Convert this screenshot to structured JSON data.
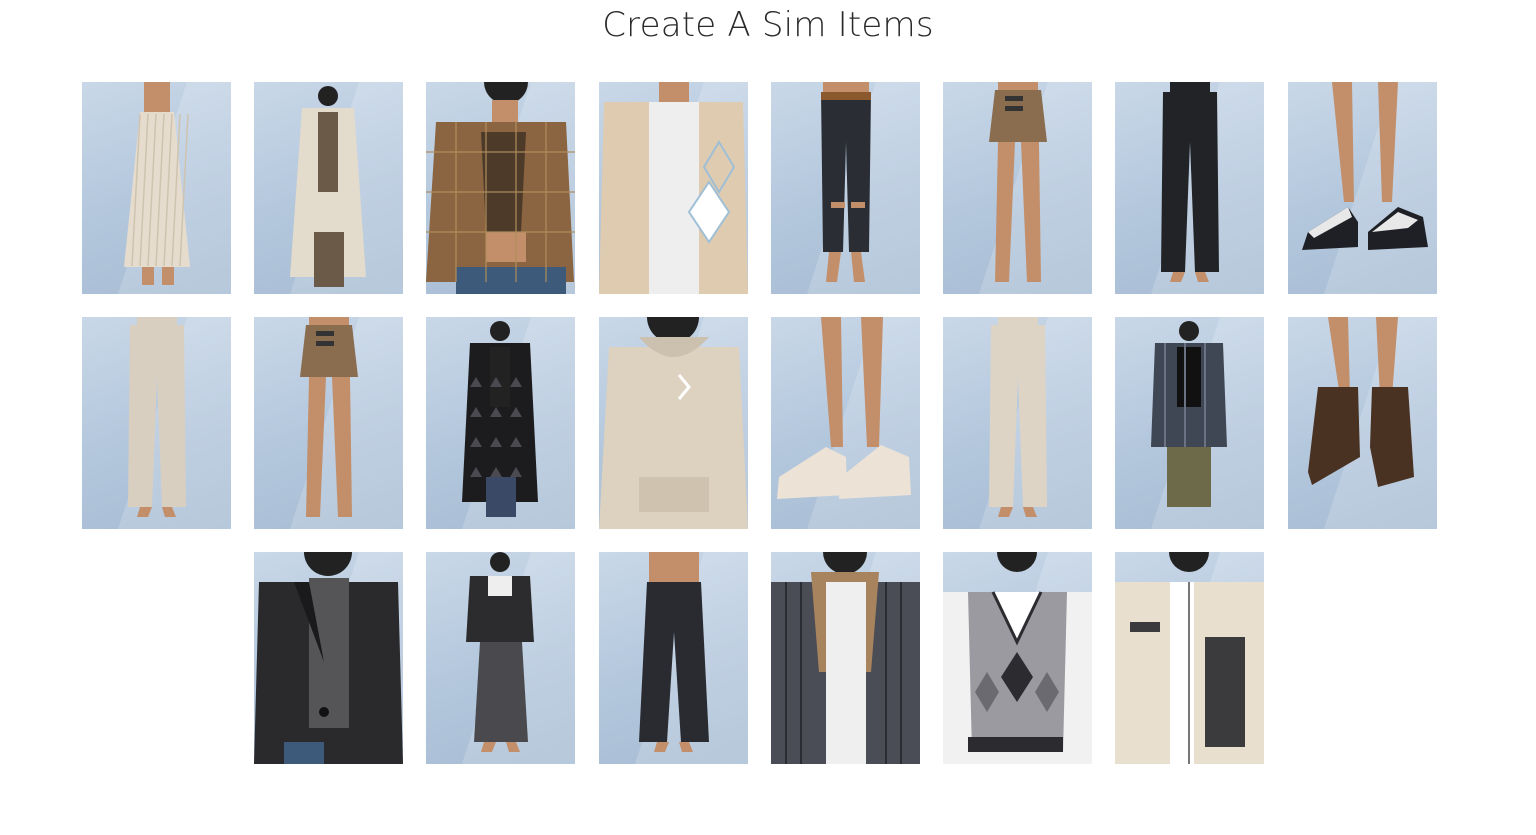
{
  "page": {
    "title": "Create A Sim Items"
  },
  "items": [
    {
      "kind": "long-skirt",
      "colors": {
        "main": "#e6dccd",
        "accent": "#cfc3b0"
      }
    },
    {
      "kind": "trench-coat",
      "colors": {
        "main": "#e3dbcb",
        "accent": "#6b5a47"
      }
    },
    {
      "kind": "plaid-jacket",
      "colors": {
        "main": "#8b6541",
        "accent": "#4e3a28"
      }
    },
    {
      "kind": "argyle-cardigan",
      "colors": {
        "main": "#dfcbb0",
        "accent": "#9fbfd6"
      }
    },
    {
      "kind": "ripped-jeans",
      "colors": {
        "main": "#2a2d33",
        "accent": "#8a5a2e"
      }
    },
    {
      "kind": "mini-skirt",
      "colors": {
        "main": "#8a6c4f",
        "accent": "#c38f6a"
      }
    },
    {
      "kind": "black-trousers",
      "colors": {
        "main": "#222326",
        "accent": "#c38f6a"
      }
    },
    {
      "kind": "sneakers",
      "colors": {
        "main": "#1f2026",
        "accent": "#e8e8e8"
      }
    },
    {
      "kind": "beige-trousers",
      "colors": {
        "main": "#d8cfc1",
        "accent": "#c38f6a"
      }
    },
    {
      "kind": "mini-skirt-2",
      "colors": {
        "main": "#8a6c4f",
        "accent": "#c38f6a"
      }
    },
    {
      "kind": "long-patterned-coat",
      "colors": {
        "main": "#1c1c1f",
        "accent": "#3a4a66"
      }
    },
    {
      "kind": "hoodie",
      "colors": {
        "main": "#ddd1c0",
        "accent": "#ffffff"
      }
    },
    {
      "kind": "chunky-sneakers",
      "colors": {
        "main": "#ece2d6",
        "accent": "#c38f6a"
      }
    },
    {
      "kind": "joggers",
      "colors": {
        "main": "#ddd4c6",
        "accent": "#c38f6a"
      }
    },
    {
      "kind": "flannel-shirt",
      "colors": {
        "main": "#3f4654",
        "accent": "#6d6a4a"
      }
    },
    {
      "kind": "ankle-boots",
      "colors": {
        "main": "#4a3222",
        "accent": "#c38f6a"
      }
    },
    {
      "kind": "black-blazer",
      "colors": {
        "main": "#2a2a2c",
        "accent": "#555558"
      }
    },
    {
      "kind": "cropped-jacket-skirt",
      "colors": {
        "main": "#2c2c2e",
        "accent": "#4a4a4e"
      }
    },
    {
      "kind": "wide-jeans",
      "colors": {
        "main": "#2a2b30",
        "accent": "#c38f6a"
      }
    },
    {
      "kind": "plaid-hooded-jacket",
      "colors": {
        "main": "#4a4d55",
        "accent": "#a8845e"
      }
    },
    {
      "kind": "argyle-vest",
      "colors": {
        "main": "#9a9aa0",
        "accent": "#2c2c30"
      }
    },
    {
      "kind": "fleece-jacket",
      "colors": {
        "main": "#e9dfcf",
        "accent": "#3b3b3e"
      }
    }
  ]
}
